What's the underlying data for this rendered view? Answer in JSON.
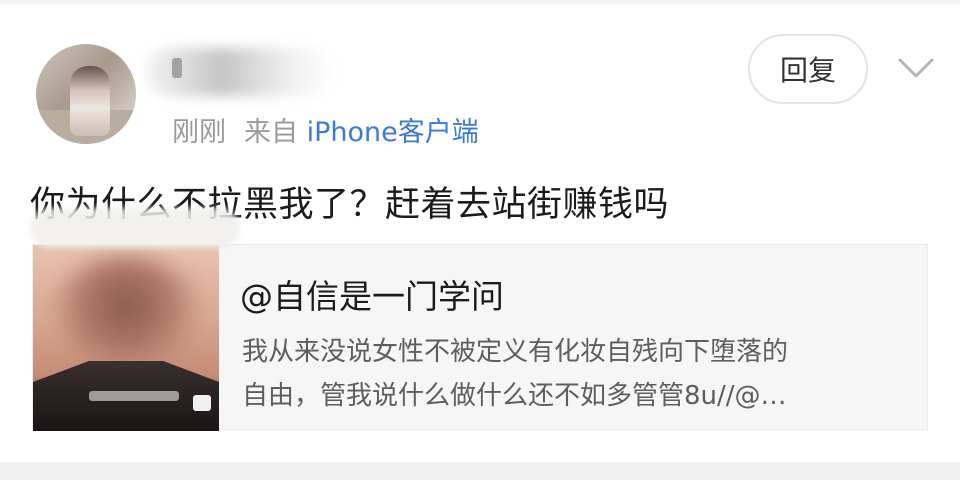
{
  "post": {
    "username": "",
    "timestamp": "刚刚",
    "source_prefix": "来自",
    "source": "iPhone客户端",
    "text": "你为什么不拉黑我了？赶着去站街赚钱吗",
    "reply_label": "回复",
    "more_icon": "chevron-down-icon"
  },
  "quoted": {
    "title": "@自信是一门学问",
    "description_line1": "我从来没说女性不被定义有化妆自残向下堕落的",
    "description_line2": "自由，管我说什么做什么还不如多管管8u//@…"
  },
  "colors": {
    "link": "#3d7bd3",
    "meta": "#9a9a9a",
    "card_bg": "#f6f6f6"
  }
}
